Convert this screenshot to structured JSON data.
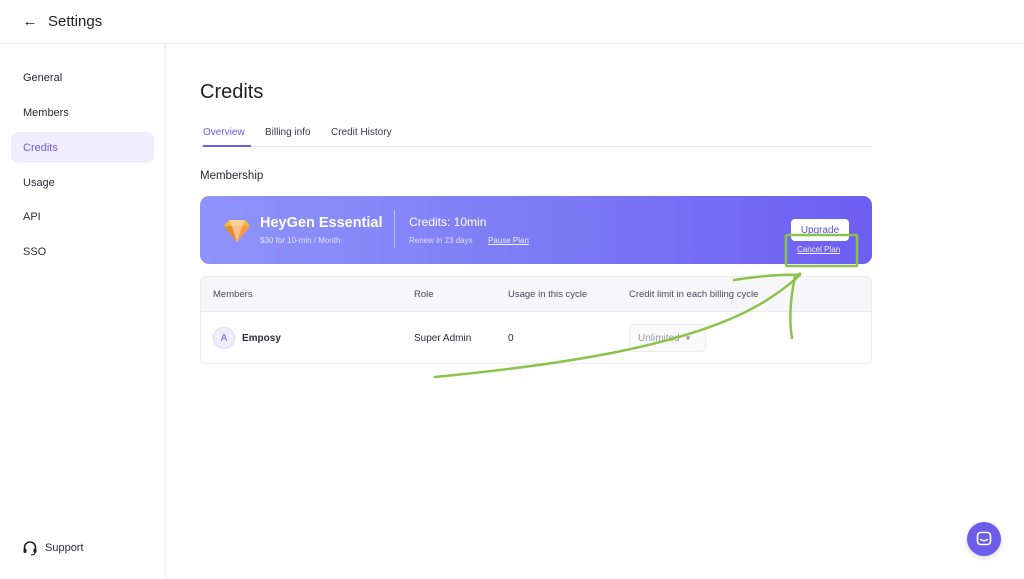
{
  "header": {
    "title": "Settings"
  },
  "sidebar": {
    "items": [
      {
        "label": "General",
        "active": false
      },
      {
        "label": "Members",
        "active": false
      },
      {
        "label": "Credits",
        "active": true
      },
      {
        "label": "Usage",
        "active": false
      },
      {
        "label": "API",
        "active": false
      },
      {
        "label": "SSO",
        "active": false
      }
    ],
    "support_label": "Support"
  },
  "main": {
    "title": "Credits",
    "tabs": [
      {
        "label": "Overview",
        "active": true
      },
      {
        "label": "Billing info",
        "active": false
      },
      {
        "label": "Credit History",
        "active": false
      }
    ],
    "section_title": "Membership",
    "plan": {
      "name": "HeyGen Essential",
      "price": "$30 for 10-min / Month",
      "credits": "Credits: 10min",
      "renew": "Renew in 23 days",
      "pause_label": "Pause Plan",
      "upgrade_label": "Upgrade",
      "cancel_label": "Cancel Plan"
    },
    "table": {
      "headers": [
        "Members",
        "Role",
        "Usage in this cycle",
        "Credit limit in each billing cycle"
      ],
      "rows": [
        {
          "avatar": "A",
          "name": "Emposy",
          "role": "Super Admin",
          "usage": "0",
          "limit": "Unlimited"
        }
      ]
    }
  },
  "colors": {
    "accent": "#6c5ce7",
    "annotation": "#8bc34a"
  }
}
